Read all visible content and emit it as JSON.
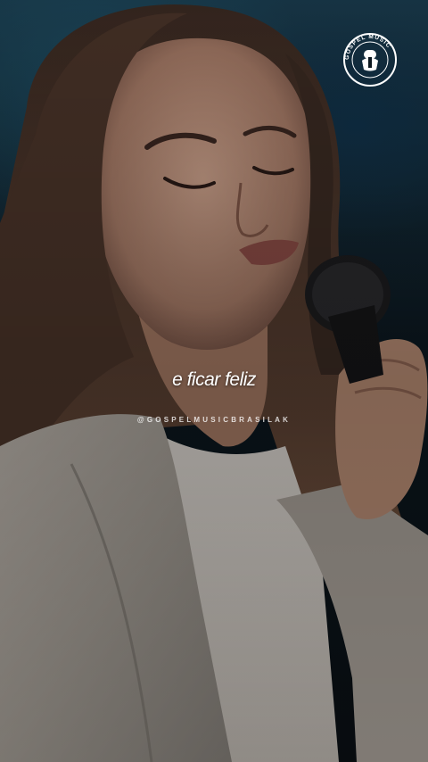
{
  "caption": {
    "text": "e ficar feliz"
  },
  "watermark": {
    "handle": "@GOSPELMUSICBRASILAK"
  },
  "logo": {
    "icon": "microphone-hand-icon",
    "ring_text": "GOSPEL MUSIC"
  },
  "colors": {
    "background_top": "#1a3c4f",
    "background_bottom": "#0a0f13",
    "caption": "#ffffff",
    "logo_fill": "#ffffff"
  }
}
